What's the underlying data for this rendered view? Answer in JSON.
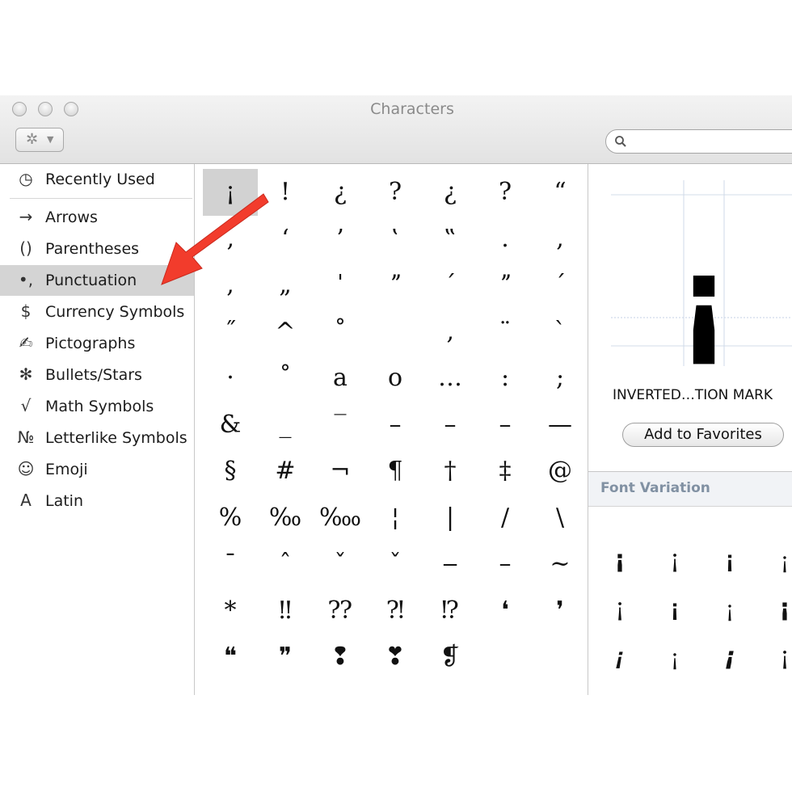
{
  "window": {
    "title": "Characters"
  },
  "toolbar": {
    "gear_icon": "gear-icon",
    "search_placeholder": ""
  },
  "sidebar": {
    "items": [
      {
        "icon": "◷",
        "icon_name": "clock-icon",
        "label": "Recently Used"
      },
      {
        "icon": "→",
        "icon_name": "arrow-icon",
        "label": "Arrows"
      },
      {
        "icon": "()",
        "icon_name": "parentheses-icon",
        "label": "Parentheses"
      },
      {
        "icon": "•,",
        "icon_name": "punctuation-icon",
        "label": "Punctuation"
      },
      {
        "icon": "$",
        "icon_name": "dollar-icon",
        "label": "Currency Symbols"
      },
      {
        "icon": "✍",
        "icon_name": "pictograph-icon",
        "label": "Pictographs"
      },
      {
        "icon": "✻",
        "icon_name": "star-icon",
        "label": "Bullets/Stars"
      },
      {
        "icon": "√",
        "icon_name": "square-root-icon",
        "label": "Math Symbols"
      },
      {
        "icon": "№",
        "icon_name": "numero-icon",
        "label": "Letterlike Symbols"
      },
      {
        "icon": "☺",
        "icon_name": "smiley-icon",
        "label": "Emoji"
      },
      {
        "icon": "A",
        "icon_name": "latin-letter-icon",
        "label": "Latin"
      }
    ],
    "selected_index": 3
  },
  "grid": {
    "selected": "¡",
    "rows": [
      [
        "¡",
        "!",
        "¿",
        "?",
        "¿",
        "?",
        "“"
      ],
      [
        "‚",
        "‘",
        "’",
        "‛",
        "‟",
        ".",
        ","
      ],
      [
        ",",
        "„",
        "ˈ",
        "ˮ",
        "ˊ",
        "ˮ",
        "ˊ"
      ],
      [
        "˝",
        "^",
        "˚",
        "",
        "‚",
        "¨",
        "ˋ"
      ],
      [
        "·",
        "˚",
        "a",
        "o",
        "…",
        ":",
        ";"
      ],
      [
        "&",
        "_",
        "‾",
        "–",
        "–",
        "–",
        "—"
      ],
      [
        "§",
        "#",
        "¬",
        "¶",
        "†",
        "‡",
        "@"
      ],
      [
        "%",
        "‰",
        "‱",
        "¦",
        "|",
        "/",
        "\\"
      ],
      [
        "ˉ",
        "ˆ",
        "ˇ",
        "ˇ",
        "‒",
        "–",
        "~"
      ],
      [
        "*",
        "‼",
        "⁇",
        "⁈",
        "⁉",
        "❛",
        "❜"
      ],
      [
        "❝",
        "❞",
        "❢",
        "❣",
        "❡",
        "",
        ""
      ]
    ]
  },
  "detail": {
    "preview_glyph": "¡",
    "char_name": "INVERTED…TION MARK",
    "add_favorites_label": "Add to Favorites",
    "font_variation_label": "Font Variation",
    "variations": [
      [
        "¡",
        "¡",
        "¡",
        "¡"
      ],
      [
        "¡",
        "¡",
        "¡",
        "¡"
      ],
      [
        "¡",
        "¡",
        "¡",
        "¡"
      ],
      [
        "¡",
        "¡",
        "¡",
        "¡"
      ]
    ]
  },
  "colors": {
    "annotation_arrow": "#f23c2c",
    "selection": "#d4d4d4"
  }
}
